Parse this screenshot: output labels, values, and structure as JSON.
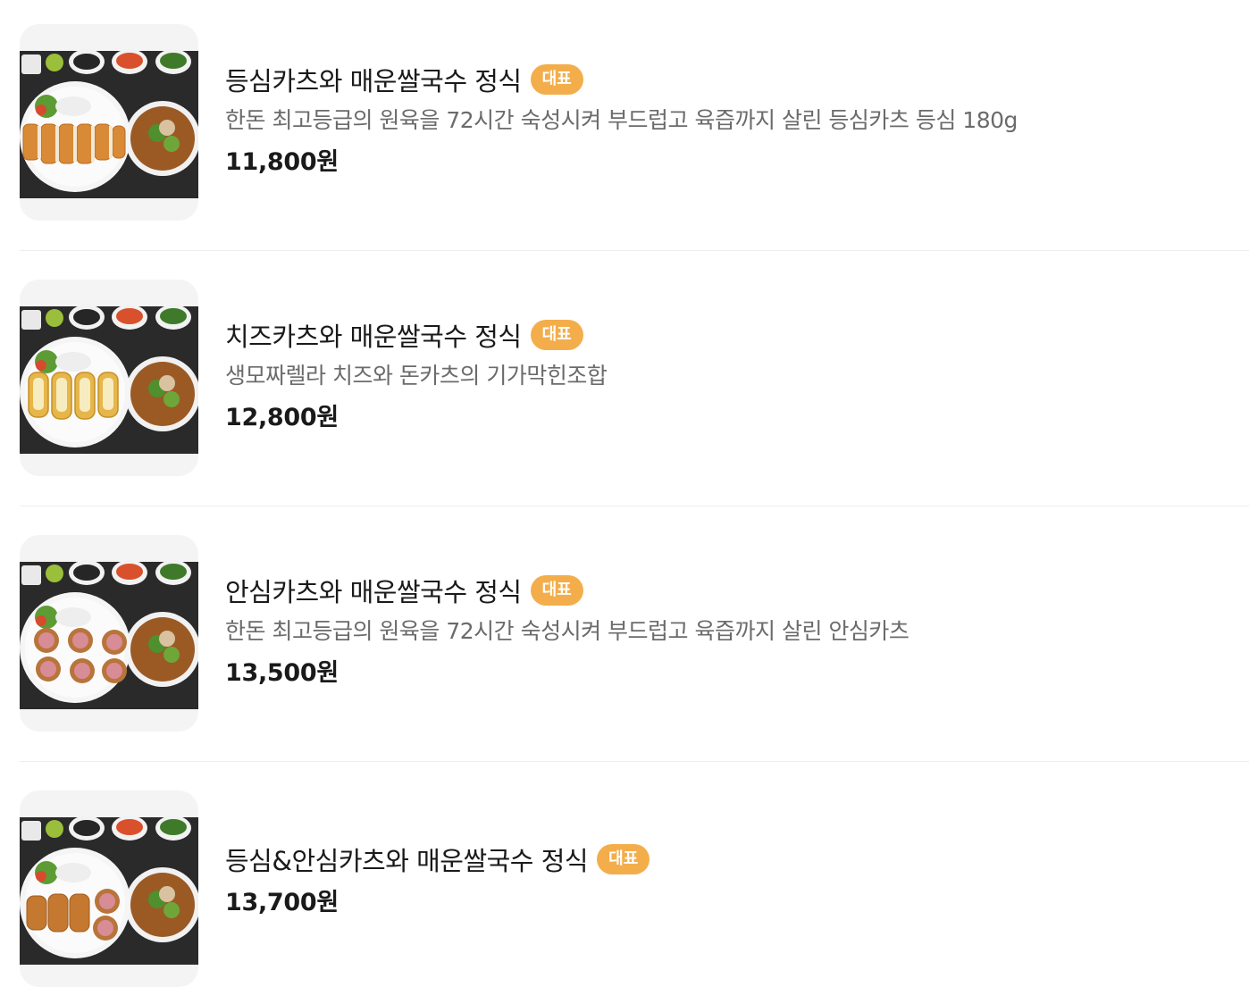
{
  "menu": {
    "items": [
      {
        "title": "등심카츠와 매운쌀국수 정식",
        "badge": "대표",
        "description": "한돈 최고등급의 원육을 72시간 숙성시켜 부드럽고 육즙까지 살린 등심카츠 등심 180g",
        "price": "11,800원",
        "image_icon": "food-photo-icon"
      },
      {
        "title": "치즈카츠와 매운쌀국수 정식",
        "badge": "대표",
        "description": "생모짜렐라 치즈와 돈카츠의 기가막힌조합",
        "price": "12,800원",
        "image_icon": "food-photo-icon"
      },
      {
        "title": "안심카츠와 매운쌀국수 정식",
        "badge": "대표",
        "description": "한돈 최고등급의 원육을 72시간 숙성시켜 부드럽고 육즙까지 살린 안심카츠",
        "price": "13,500원",
        "image_icon": "food-photo-icon"
      },
      {
        "title": "등심&안심카츠와 매운쌀국수 정식",
        "badge": "대표",
        "description": "",
        "price": "13,700원",
        "image_icon": "food-photo-icon"
      }
    ]
  },
  "colors": {
    "badge_bg": "#f3ae4b",
    "title": "#1a1a1a",
    "description": "#6b6b6b",
    "divider": "#eeeeee"
  }
}
